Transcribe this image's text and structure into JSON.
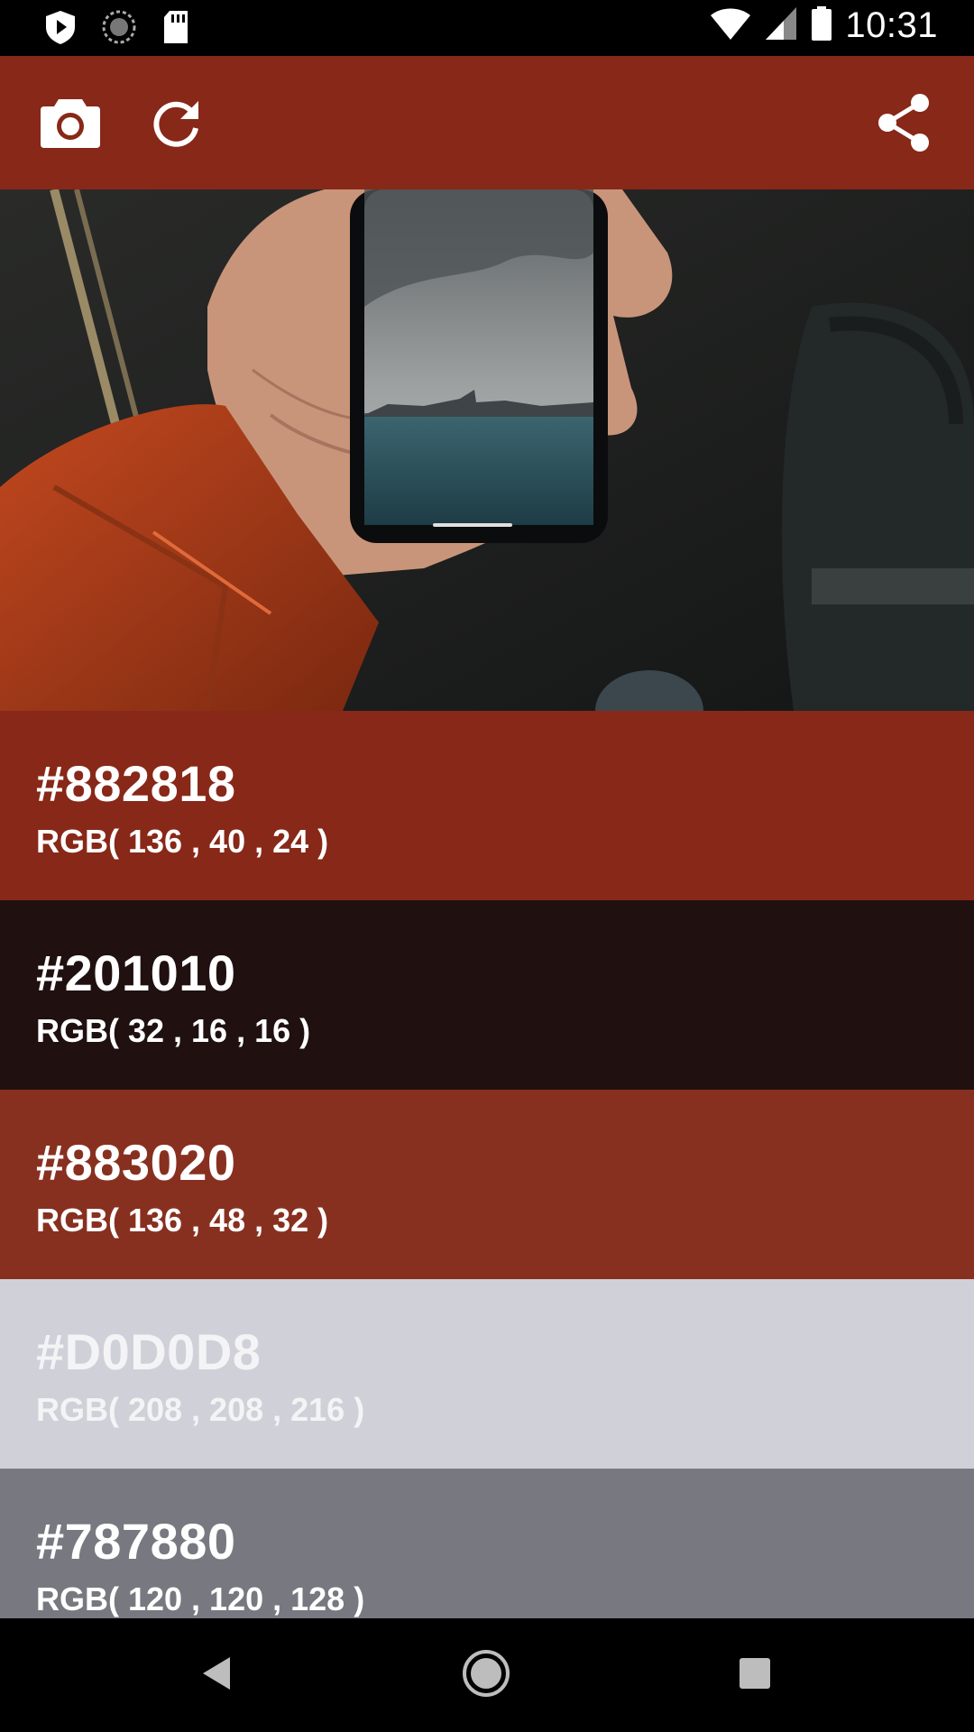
{
  "status_bar": {
    "time": "10:31",
    "icons": [
      "play-protect-icon",
      "sync-icon",
      "sd-card-icon",
      "wifi-icon",
      "signal-icon",
      "battery-icon"
    ]
  },
  "toolbar": {
    "background": "#882818",
    "actions": [
      "camera-icon",
      "refresh-icon",
      "share-icon"
    ]
  },
  "swatches": [
    {
      "hex": "#882818",
      "rgb": "RGB( 136 , 40 , 24 )",
      "bg": "#882818",
      "fg": "#ffffff"
    },
    {
      "hex": "#201010",
      "rgb": "RGB( 32 , 16 , 16 )",
      "bg": "#201010",
      "fg": "#ffffff"
    },
    {
      "hex": "#883020",
      "rgb": "RGB( 136 , 48 , 32 )",
      "bg": "#883020",
      "fg": "#ffffff"
    },
    {
      "hex": "#D0D0D8",
      "rgb": "RGB( 208 , 208 , 216 )",
      "bg": "#d0d0d8",
      "fg": "#f4f4f6"
    },
    {
      "hex": "#787880",
      "rgb": "RGB( 120 , 120 , 128 )",
      "bg": "#787880",
      "fg": "#ffffff"
    }
  ],
  "nav_bar": {
    "buttons": [
      "back-icon",
      "home-icon",
      "recents-icon"
    ]
  }
}
